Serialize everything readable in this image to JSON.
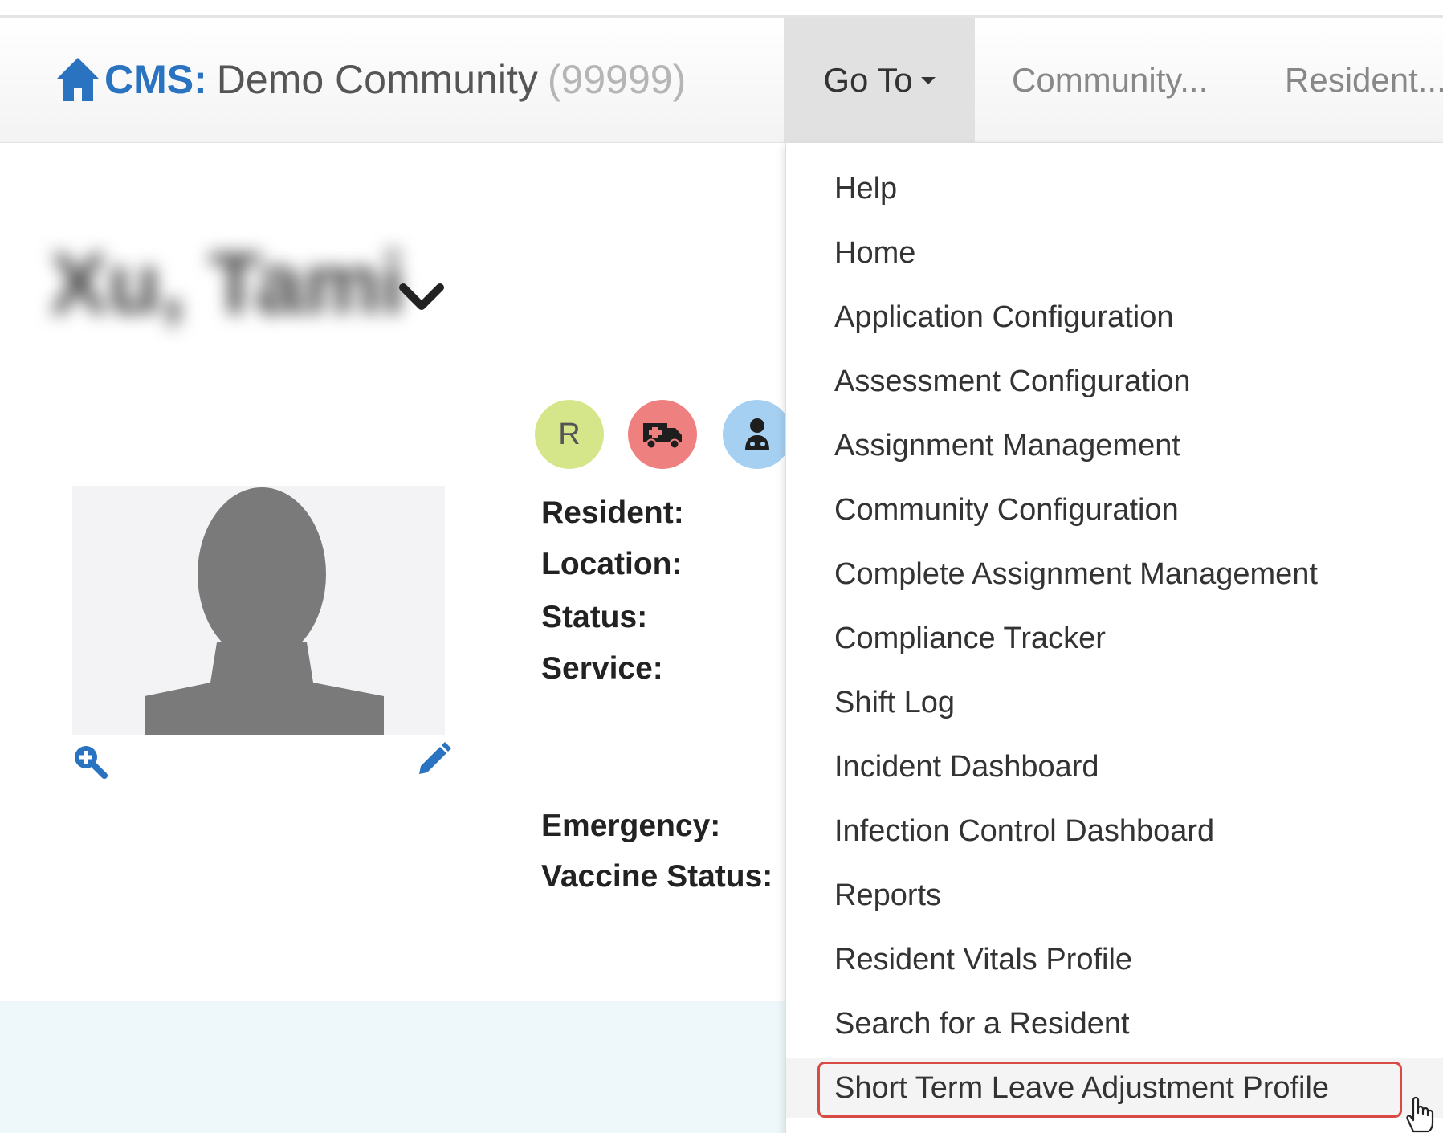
{
  "navbar": {
    "brand_prefix": "CMS:",
    "community_name": "Demo Community",
    "community_code": "(99999)",
    "goto_label": "Go To",
    "community_menu": "Community...",
    "resident_menu": "Resident..."
  },
  "resident": {
    "name": "Xu, Tami",
    "badge_r": "R",
    "labels": {
      "resident": "Resident:",
      "location": "Location:",
      "status": "Status:",
      "service": "Service:",
      "emergency": "Emergency:",
      "vaccine_status": "Vaccine Status:"
    }
  },
  "goto_menu": {
    "items": [
      "Help",
      "Home",
      "Application Configuration",
      "Assessment Configuration",
      "Assignment Management",
      "Community Configuration",
      "Complete Assignment Management",
      "Compliance Tracker",
      "Shift Log",
      "Incident Dashboard",
      "Infection Control Dashboard",
      "Reports",
      "Resident Vitals Profile",
      "Search for a Resident",
      "Short Term Leave Adjustment Profile"
    ],
    "hovered_item": "Short Term Leave Adjustment Profile"
  },
  "colors": {
    "brand_blue": "#2a73c0",
    "highlight_red": "#d84b45",
    "badge_green": "#d5e68a",
    "badge_red": "#ef8080",
    "badge_blue": "#a6d0f2"
  },
  "icons": {
    "brand": "home-icon",
    "name_toggle": "chevron-down-icon",
    "photo_zoom": "zoom-in-icon",
    "photo_edit": "pencil-icon",
    "badge_transport": "ambulance-icon",
    "badge_physician": "doctor-icon",
    "pointer": "hand-cursor-icon"
  }
}
